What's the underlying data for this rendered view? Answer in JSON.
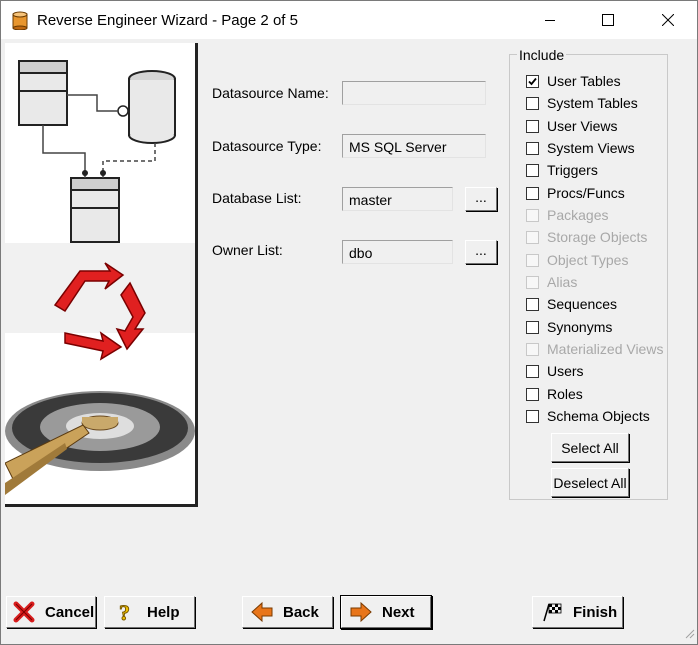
{
  "window": {
    "title": "Reverse Engineer Wizard - Page 2 of 5",
    "controls": {
      "minimize": "minimize-icon",
      "maximize": "maximize-icon",
      "close": "close-icon"
    }
  },
  "form": {
    "datasource_name": {
      "label": "Datasource Name:",
      "value": ""
    },
    "datasource_type": {
      "label": "Datasource Type:",
      "value": "MS SQL Server"
    },
    "database_list": {
      "label": "Database List:",
      "value": "master",
      "browse": "..."
    },
    "owner_list": {
      "label": "Owner List:",
      "value": "dbo",
      "browse": "..."
    }
  },
  "include": {
    "title": "Include",
    "items": [
      {
        "label": "User Tables",
        "checked": true,
        "enabled": true
      },
      {
        "label": "System Tables",
        "checked": false,
        "enabled": true
      },
      {
        "label": "User Views",
        "checked": false,
        "enabled": true
      },
      {
        "label": "System Views",
        "checked": false,
        "enabled": true
      },
      {
        "label": "Triggers",
        "checked": false,
        "enabled": true
      },
      {
        "label": "Procs/Funcs",
        "checked": false,
        "enabled": true
      },
      {
        "label": "Packages",
        "checked": false,
        "enabled": false
      },
      {
        "label": "Storage Objects",
        "checked": false,
        "enabled": false
      },
      {
        "label": "Object Types",
        "checked": false,
        "enabled": false
      },
      {
        "label": "Alias",
        "checked": false,
        "enabled": false
      },
      {
        "label": "Sequences",
        "checked": false,
        "enabled": true
      },
      {
        "label": "Synonyms",
        "checked": false,
        "enabled": true
      },
      {
        "label": "Materialized Views",
        "checked": false,
        "enabled": false
      },
      {
        "label": "Users",
        "checked": false,
        "enabled": true
      },
      {
        "label": "Roles",
        "checked": false,
        "enabled": true
      },
      {
        "label": "Schema Objects",
        "checked": false,
        "enabled": true
      }
    ],
    "select_all": "Select All",
    "deselect_all": "Deselect All"
  },
  "buttons": {
    "cancel": "Cancel",
    "help": "Help",
    "back": "Back",
    "next": "Next",
    "finish": "Finish"
  },
  "colors": {
    "accent_red": "#e02020",
    "arrow_orange": "#e8751a",
    "help_yellow": "#f0c000",
    "panel_border": "#222222",
    "disabled_text": "#a8a8a8"
  }
}
